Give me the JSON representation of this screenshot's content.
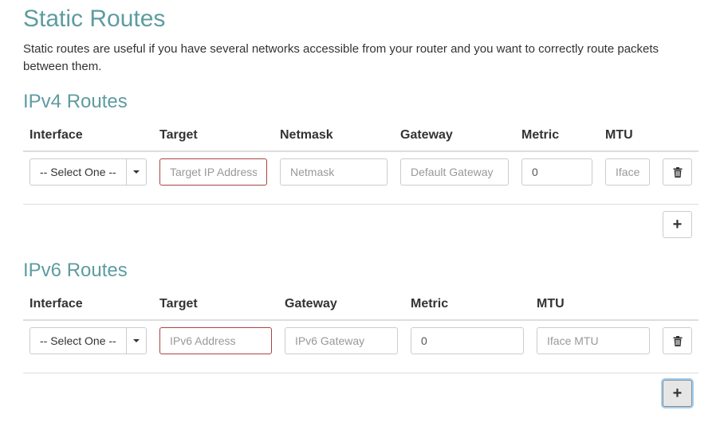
{
  "page": {
    "title": "Static Routes",
    "description": "Static routes are useful if you have several networks accessible from your router and you want to correctly route packets between them."
  },
  "ipv4": {
    "title": "IPv4 Routes",
    "headers": {
      "interface": "Interface",
      "target": "Target",
      "netmask": "Netmask",
      "gateway": "Gateway",
      "metric": "Metric",
      "mtu": "MTU"
    },
    "row": {
      "interface": "-- Select One --",
      "target_placeholder": "Target IP Address",
      "netmask_placeholder": "Netmask",
      "gateway_placeholder": "Default Gateway",
      "metric_value": "0",
      "mtu_placeholder": "Iface MTU"
    }
  },
  "ipv6": {
    "title": "IPv6 Routes",
    "headers": {
      "interface": "Interface",
      "target": "Target",
      "gateway": "Gateway",
      "metric": "Metric",
      "mtu": "MTU"
    },
    "row": {
      "interface": "-- Select One --",
      "target_placeholder": "IPv6 Address",
      "gateway_placeholder": "IPv6 Gateway",
      "metric_value": "0",
      "mtu_placeholder": "Iface MTU"
    }
  },
  "buttons": {
    "add": "+"
  },
  "icons": {
    "delete": "trash-icon",
    "dropdown": "caret-down-icon"
  },
  "colors": {
    "heading": "#5e9ca0",
    "error_border": "#a94442"
  }
}
